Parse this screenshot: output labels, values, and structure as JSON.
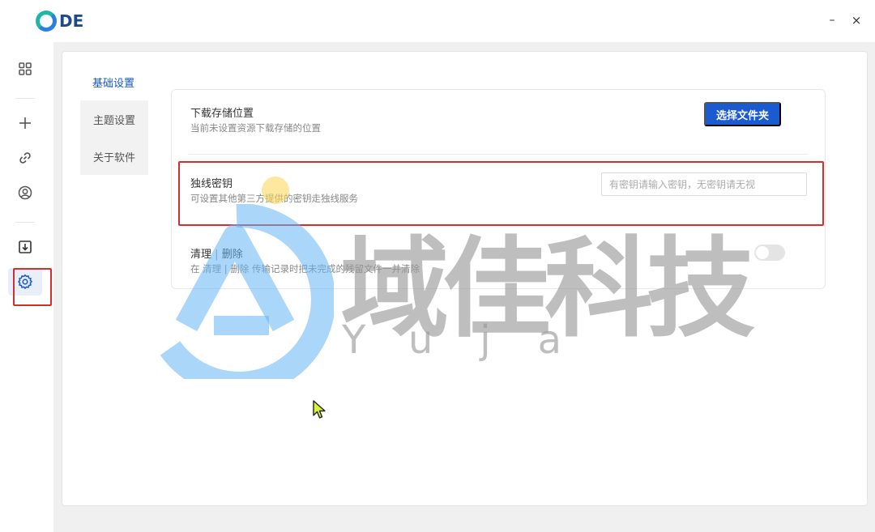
{
  "app": {
    "logo_text": "DE",
    "window_minimize": "–",
    "window_close": "×"
  },
  "rail": {
    "items": [
      {
        "icon": "grid-icon"
      },
      {
        "icon": "plus-icon"
      },
      {
        "icon": "link-icon"
      },
      {
        "icon": "user-icon"
      },
      {
        "icon": "download-icon"
      },
      {
        "icon": "gear-icon",
        "active": true
      }
    ]
  },
  "settings": {
    "tabs": [
      {
        "label": "基础设置",
        "active": true
      },
      {
        "label": "主题设置"
      },
      {
        "label": "关于软件"
      }
    ],
    "download": {
      "title": "下载存储位置",
      "desc": "当前未设置资源下载存储的位置",
      "button": "选择文件夹"
    },
    "key": {
      "title": "独线密钥",
      "desc": "可设置其他第三方提供的密钥走独线服务",
      "placeholder": "有密钥请输入密钥，无密钥请无视",
      "value": ""
    },
    "cleanup": {
      "title_a": "清理",
      "title_sep": "|",
      "title_b": "删除",
      "desc": "在 清理 | 删除 传输记录时把未完成的残留文件一并清除",
      "toggle_on": false
    }
  },
  "watermark": {
    "main": "域佳科技",
    "sub": "Yuja"
  },
  "colors": {
    "accent": "#1a5bd0",
    "highlight_box": "#d92d2d",
    "workspace_bg": "#f0f0f0"
  }
}
